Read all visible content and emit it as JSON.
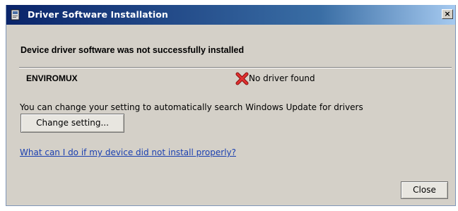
{
  "window": {
    "title": "Driver Software Installation",
    "close_glyph": "×"
  },
  "main": {
    "heading": "Device driver software was not successfully installed",
    "device": {
      "name": "ENVIROMUX",
      "status": "No driver found",
      "status_icon": "error-x-icon"
    },
    "info_text": "You can change your setting to automatically search Windows Update for drivers",
    "change_button_label": "Change setting...",
    "help_link": "What can I do if my device did not install properly?"
  },
  "footer": {
    "close_label": "Close"
  },
  "colors": {
    "window_bg": "#d4d0c8",
    "title_bar": "#0a246a",
    "link": "#1a3fb0",
    "error_red": "#d42020"
  }
}
